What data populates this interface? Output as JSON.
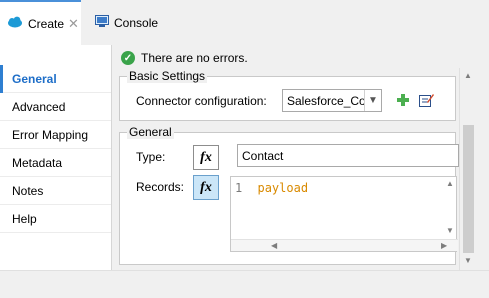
{
  "tabs": {
    "create": {
      "label": "Create",
      "close": "✕"
    },
    "console": {
      "label": "Console"
    }
  },
  "sidebar": {
    "items": [
      {
        "label": "General",
        "active": true
      },
      {
        "label": "Advanced"
      },
      {
        "label": "Error Mapping"
      },
      {
        "label": "Metadata"
      },
      {
        "label": "Notes"
      },
      {
        "label": "Help"
      }
    ]
  },
  "status": {
    "text": "There are no errors."
  },
  "basic_settings": {
    "title": "Basic Settings",
    "connector_label": "Connector configuration:",
    "connector_value": "Salesforce_Config"
  },
  "general": {
    "title": "General",
    "type_label": "Type:",
    "type_value": "Contact",
    "records_label": "Records:",
    "fx": "fx",
    "editor": {
      "line_number": "1",
      "code": "payload"
    }
  },
  "colors": {
    "accent": "#2f7fd1",
    "status_ok": "#3aa34a",
    "code": "#d98a00",
    "add_icon": "#4caf50"
  }
}
